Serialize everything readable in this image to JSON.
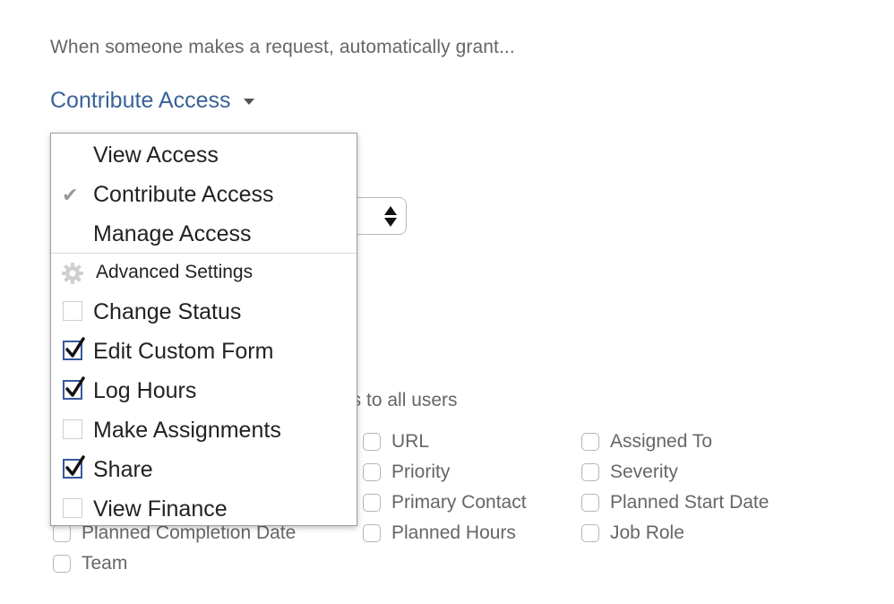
{
  "intro_text": "When someone makes a request, automatically grant...",
  "access_select": {
    "value": "Contribute Access"
  },
  "menu": {
    "access_levels": [
      {
        "label": "View Access",
        "selected": false
      },
      {
        "label": "Contribute Access",
        "selected": true
      },
      {
        "label": "Manage Access",
        "selected": false
      }
    ],
    "advanced_label": "Advanced Settings",
    "permissions": [
      {
        "label": "Change Status",
        "checked": false
      },
      {
        "label": "Edit Custom Form",
        "checked": true
      },
      {
        "label": "Log Hours",
        "checked": true
      },
      {
        "label": "Make Assignments",
        "checked": false
      },
      {
        "label": "Share",
        "checked": true
      },
      {
        "label": "View Finance",
        "checked": false
      }
    ]
  },
  "fields_partial_text": "ls to all users",
  "fields": [
    {
      "label": "URL",
      "checked": false
    },
    {
      "label": "Assigned To",
      "checked": false
    },
    {
      "label": "Priority",
      "checked": false
    },
    {
      "label": "Severity",
      "checked": false
    },
    {
      "label": "Primary Contact",
      "checked": false
    },
    {
      "label": "Planned Start Date",
      "checked": false
    },
    {
      "label": "Planned Completion Date",
      "checked": false
    },
    {
      "label": "Planned Hours",
      "checked": false
    },
    {
      "label": "Job Role",
      "checked": false
    },
    {
      "label": "Team",
      "checked": false
    }
  ],
  "colors": {
    "accent": "#3a6299",
    "checkbox_checked": "#35589c",
    "muted_text": "#666666"
  }
}
